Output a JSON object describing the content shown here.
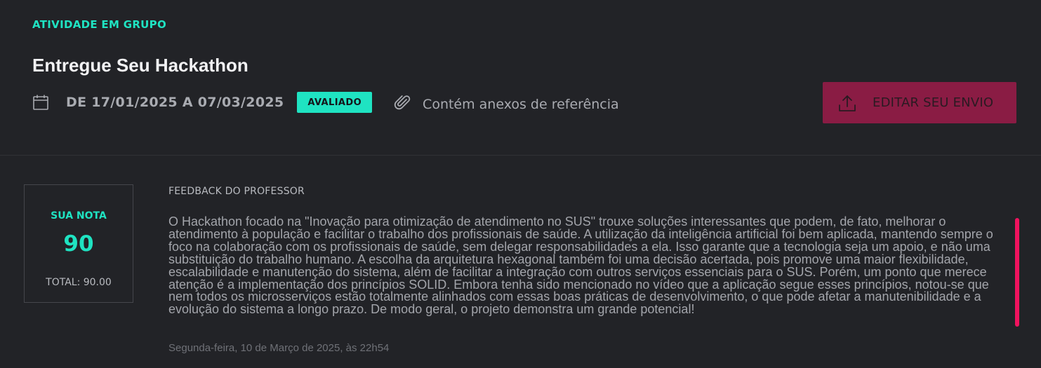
{
  "header": {
    "activity_type": "ATIVIDADE EM GRUPO",
    "title": "Entregue Seu Hackathon",
    "date_range": "DE 17/01/2025 A 07/03/2025",
    "status_badge": "AVALIADO",
    "attachments_text": "Contém anexos de referência",
    "edit_button_label": "EDITAR SEU ENVIO",
    "icons": {
      "date": "calendar-icon",
      "attachments": "paperclip-icon",
      "edit": "upload-icon"
    }
  },
  "grade": {
    "label": "SUA NOTA",
    "value": "90",
    "total": "TOTAL: 90.00"
  },
  "feedback": {
    "title": "FEEDBACK DO PROFESSOR",
    "body": "O Hackathon focado na \"Inovação para otimização de atendimento no SUS\" trouxe soluções interessantes que podem, de fato, melhorar o atendimento à população e facilitar o trabalho dos profissionais de saúde. A utilização da inteligência artificial foi bem aplicada, mantendo sempre o foco na colaboração com os profissionais de saúde, sem delegar responsabilidades a ela. Isso garante que a tecnologia seja um apoio, e não uma substituição do trabalho humano. A escolha da arquitetura hexagonal também foi uma decisão acertada, pois promove uma maior flexibilidade, escalabilidade e manutenção do sistema, além de facilitar a integração com outros serviços essenciais para o SUS. Porém, um ponto que merece atenção é a implementação dos princípios SOLID. Embora tenha sido mencionado no vídeo que a aplicação segue esses princípios, notou-se que nem todos os microsserviços estão totalmente alinhados com essas boas práticas de desenvolvimento, o que pode afetar a manutenibilidade e a evolução do sistema a longo prazo. De modo geral, o projeto demonstra um grande potencial!",
    "date": "Segunda-feira, 10 de Março de 2025, às 22h54"
  },
  "colors": {
    "background": "#222327",
    "accent": "#1fe3c2",
    "button": "#8a1c44",
    "scrollbar": "#f0135e"
  }
}
